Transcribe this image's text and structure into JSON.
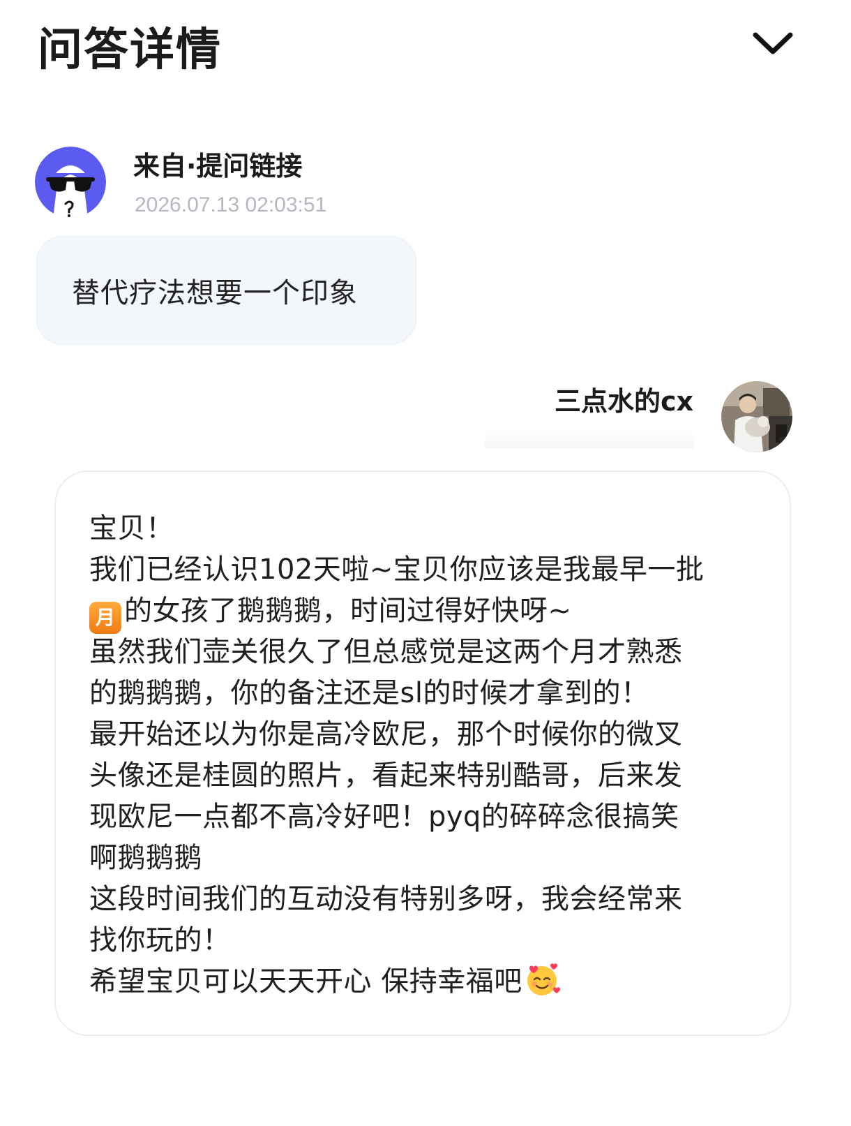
{
  "header": {
    "title": "问答详情",
    "collapse_icon": "chevron-down-icon"
  },
  "question": {
    "asker_name": "来自·提问链接",
    "timestamp": "2026.07.13 02:03:51",
    "text": "替代疗法想要一个印象",
    "avatar_icon": "anonymous-sunglasses-avatar"
  },
  "answer": {
    "answerer_name": "三点水的cx",
    "avatar_icon": "user-photo-avatar",
    "lines": [
      "宝贝！",
      "我们已经认识102天啦~宝贝你应该是我最早一批",
      "的女孩了鹅鹅鹅，时间过得好快呀~",
      "虽然我们壶关很久了但总感觉是这两个月才熟悉",
      "的鹅鹅鹅，你的备注还是sl的时候才拿到的！",
      "最开始还以为你是高冷欧尼，那个时候你的微叉",
      "头像还是桂圆的照片，看起来特别酷哥，后来发",
      "现欧尼一点都不高冷好吧！pyq的碎碎念很搞笑",
      "啊鹅鹅鹅",
      "这段时间我们的互动没有特别多呀，我会经常来",
      "找你玩的！",
      "希望宝贝可以天天开心 保持幸福吧"
    ],
    "month_badge": "月",
    "emoji": "smiling-face-with-hearts-emoji"
  },
  "colors": {
    "bubble_bg": "#f3f7fc",
    "timestamp": "#b4b8c0",
    "avatar_bg": "#5b5bf0",
    "month_badge": "#f5891f"
  }
}
